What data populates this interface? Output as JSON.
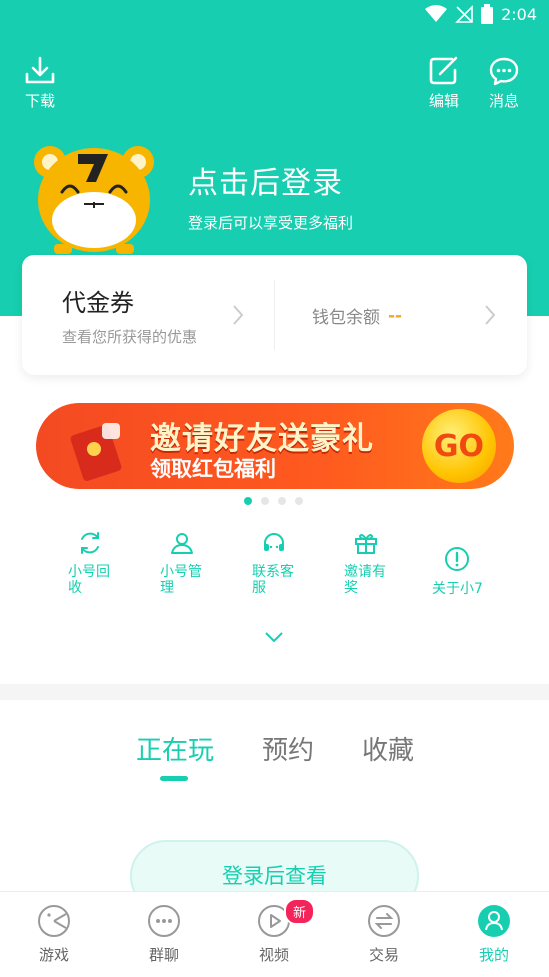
{
  "status_bar": {
    "time": "2:04"
  },
  "header": {
    "download_label": "下载",
    "edit_label": "编辑",
    "messages_label": "消息",
    "login_title": "点击后登录",
    "login_subtitle": "登录后可以享受更多福利"
  },
  "card": {
    "voucher_title": "代金券",
    "voucher_subtitle": "查看您所获得的优惠",
    "wallet_label": "钱包余额",
    "wallet_value": "--"
  },
  "banner": {
    "title": "邀请好友送豪礼",
    "subtitle": "领取红包福利",
    "go_label": "GO",
    "active_page": 1,
    "total_pages": 4
  },
  "quick_menu": [
    {
      "label": "小号回收",
      "icon": "recycle-icon"
    },
    {
      "label": "小号管理",
      "icon": "account-manage-icon"
    },
    {
      "label": "联系客服",
      "icon": "headset-icon"
    },
    {
      "label": "邀请有奖",
      "icon": "gift-icon"
    },
    {
      "label": "关于小7",
      "icon": "info-icon"
    }
  ],
  "tabs": [
    {
      "label": "正在玩",
      "active": true
    },
    {
      "label": "预约",
      "active": false
    },
    {
      "label": "收藏",
      "active": false
    }
  ],
  "view_button_label": "登录后查看",
  "bottom_nav": [
    {
      "label": "游戏",
      "icon": "game-icon",
      "active": false
    },
    {
      "label": "群聊",
      "icon": "chat-icon",
      "active": false
    },
    {
      "label": "视频",
      "icon": "video-icon",
      "active": false,
      "badge": "新"
    },
    {
      "label": "交易",
      "icon": "trade-icon",
      "active": false
    },
    {
      "label": "我的",
      "icon": "profile-icon",
      "active": true
    }
  ],
  "colors": {
    "accent": "#17cfb0",
    "wallet_value": "#f5a623",
    "badge": "#f4245a"
  }
}
